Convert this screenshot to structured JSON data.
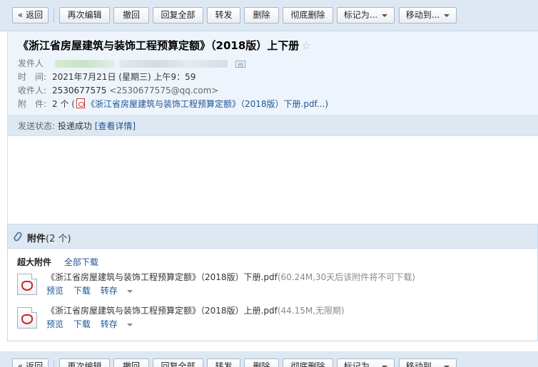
{
  "toolbar": {
    "back": "« 返回",
    "reedit": "再次编辑",
    "recall": "撤回",
    "reply_all": "回复全部",
    "forward": "转发",
    "delete": "删除",
    "delete_perm": "彻底删除",
    "mark_as": "标记为...",
    "move_to": "移动到..."
  },
  "email": {
    "subject": "《浙江省房屋建筑与装饰工程预算定额》（2018版）上下册",
    "star": "☆",
    "sender_label": "发件人",
    "time_label": "时　间:",
    "time_value": "2021年7月21日 (星期三) 上午9：59",
    "recipient_label": "收件人:",
    "recipient_name": "2530677575",
    "recipient_addr": "<2530677575@qq.com>",
    "attach_label": "附　件:",
    "attach_count": "2 个",
    "attach_paren_open": "(",
    "attach_name": "《浙江省房屋建筑与装饰工程预算定额》（2018版）下册.pdf...",
    "attach_paren_close": ")",
    "status_label": "发送状态:",
    "status_value": "投递成功",
    "status_link": "[查看详情]"
  },
  "attachments": {
    "title": "附件",
    "count": "(2 个)",
    "super_label": "超大附件",
    "download_all": "全部下载",
    "files": [
      {
        "name": "《浙江省房屋建筑与装饰工程预算定额》（2018版）下册.pdf",
        "meta": "(60.24M,30天后该附件将不可下载)",
        "preview": "预览",
        "download": "下载",
        "save": "转存"
      },
      {
        "name": "《浙江省房屋建筑与装饰工程预算定额》（2018版）上册.pdf",
        "meta": "(44.15M,无限期)",
        "preview": "预览",
        "download": "下载",
        "save": "转存"
      }
    ]
  },
  "colors": {
    "toolbar_bg": "#dde8f3",
    "header_bg": "#eef4fb",
    "link": "#1e5494",
    "pdf_red": "#d1241e"
  }
}
